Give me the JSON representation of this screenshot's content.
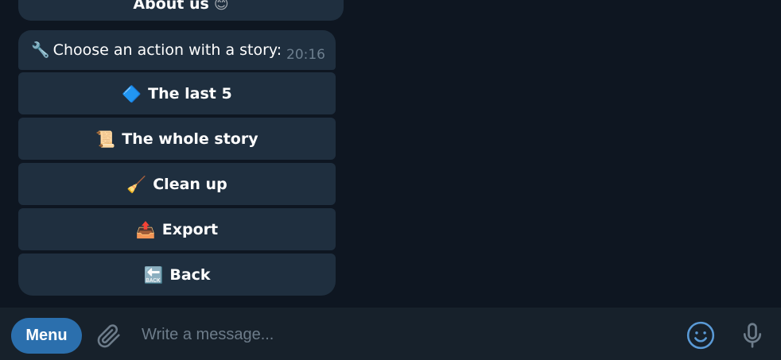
{
  "chat": {
    "previous_button": {
      "label": "About us",
      "emoji": "😊"
    },
    "message": {
      "emoji": "🔧",
      "text": "Choose an action with a story:",
      "time": "20:16"
    },
    "keyboard": [
      {
        "emoji": "🔷",
        "label": "The last 5"
      },
      {
        "emoji": "📜",
        "label": "The whole story"
      },
      {
        "emoji": "🧹",
        "label": "Clean up"
      },
      {
        "emoji": "📤",
        "label": "Export"
      },
      {
        "emoji": "🔙",
        "label": "Back"
      }
    ]
  },
  "input_bar": {
    "menu_label": "Menu",
    "placeholder": "Write a message...",
    "icons": [
      "paperclip-icon",
      "emoji-smile-icon",
      "microphone-icon"
    ]
  },
  "colors": {
    "background": "#0e1621",
    "bubble": "#1f2f3f",
    "input_bar": "#17212b",
    "accent": "#2b6fad",
    "icon_blue": "#5a9ad6",
    "muted": "#6d7f8f"
  }
}
